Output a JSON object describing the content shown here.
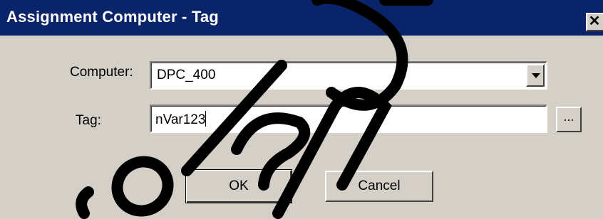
{
  "window": {
    "title": "Assignment Computer - Tag",
    "close_label": "✕"
  },
  "form": {
    "computer_label": "Computer:",
    "computer_value": "DPC_400",
    "tag_label": "Tag:",
    "tag_value": "nVar123",
    "browse_label": "..."
  },
  "buttons": {
    "ok_label": "OK",
    "cancel_label": "Cancel"
  },
  "colors": {
    "titlebar": "#0a246a",
    "dialog_face": "#d4d0c8"
  },
  "icons": {
    "close": "close-icon",
    "dropdown": "chevron-down-icon"
  }
}
